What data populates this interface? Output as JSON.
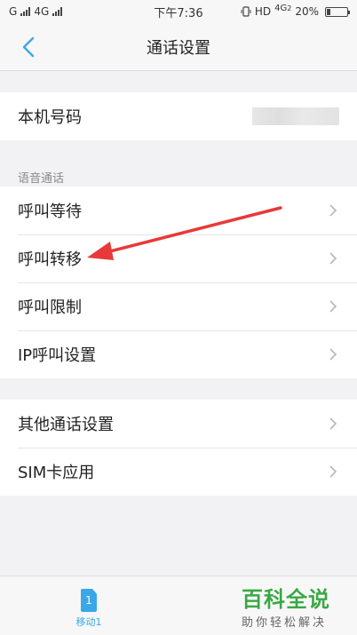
{
  "status_bar": {
    "left_carrier1": "G",
    "left_carrier2": "4G",
    "time": "下午7:36",
    "right_indicators": "HD",
    "network_type": "4G",
    "network_sub": "2",
    "battery_percent": "20%",
    "battery_level": 0.2
  },
  "header": {
    "title": "通话设置"
  },
  "phone_number": {
    "label": "本机号码"
  },
  "voice_section": {
    "title": "语音通话",
    "items": [
      {
        "label": "呼叫等待"
      },
      {
        "label": "呼叫转移"
      },
      {
        "label": "呼叫限制"
      },
      {
        "label": "IP呼叫设置"
      }
    ]
  },
  "other_section": {
    "items": [
      {
        "label": "其他通话设置"
      },
      {
        "label": "SIM卡应用"
      }
    ]
  },
  "bottom_bar": {
    "sim_number": "1",
    "sim_label": "移动1"
  },
  "watermark": {
    "main": "百科全说",
    "sub": "助你轻松解决"
  },
  "colors": {
    "accent": "#3aa7e8",
    "arrow": "#e8393a",
    "watermark": "#3aa844"
  }
}
